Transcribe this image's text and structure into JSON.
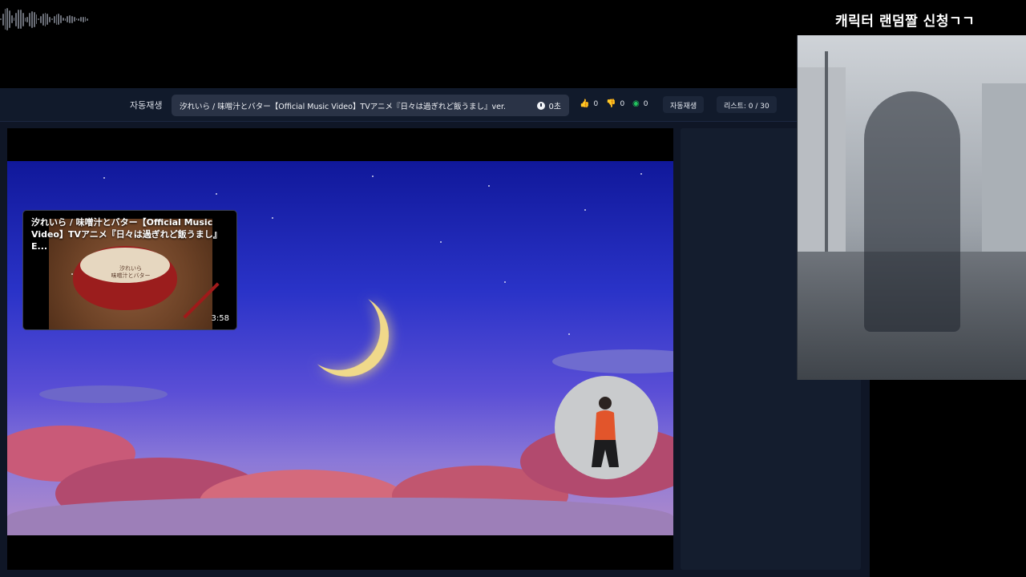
{
  "topbar": {
    "autoplay_label": "자동재생",
    "now_playing_title": "汐れいら / 味噌汁とバター【Official Music Video】TVアニメ『日々は過ぎれど飯うまし』ver.",
    "elapsed": "0초",
    "likes": "0",
    "dislikes": "0",
    "views": "0",
    "autoplay_button": "자동재생",
    "list_count": "리스트: 0 / 30"
  },
  "player": {
    "mini_title": "汐れいら / 味噌汁とバター【Official Music Video】TVアニメ『日々は過ぎれど飯うまし』E...",
    "mini_duration": "3:58",
    "thumb_text_line1": "汐れいら",
    "thumb_text_line2": "味噌汁とバター"
  },
  "overlay": {
    "character_title": "캐릭터 랜덤짤 신청ㄱㄱ"
  },
  "icons": {
    "clock": "clock-icon",
    "like": "thumbs-up-icon",
    "dislike": "thumbs-down-icon",
    "views": "eye-icon"
  },
  "colors": {
    "like": "#3b82f6",
    "dislike": "#ef4444",
    "views": "#22c55e"
  }
}
